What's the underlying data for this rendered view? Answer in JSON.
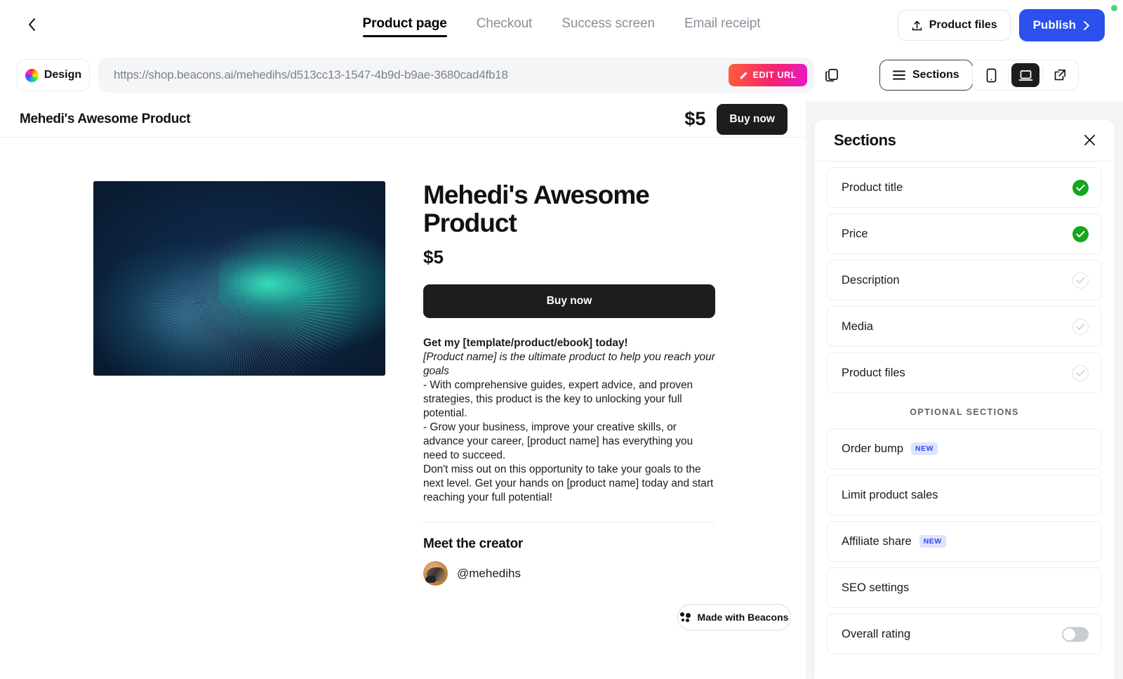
{
  "topbar": {
    "back_icon": "chevron-left-icon",
    "tabs": [
      {
        "label": "Product page",
        "active": true
      },
      {
        "label": "Checkout",
        "active": false
      },
      {
        "label": "Success screen",
        "active": false
      },
      {
        "label": "Email receipt",
        "active": false
      }
    ],
    "product_files_label": "Product files",
    "publish_label": "Publish",
    "status_dot_color": "#4ad66d",
    "publish_color": "#2b50ed"
  },
  "urlbar": {
    "design_label": "Design",
    "url": "https://shop.beacons.ai/mehedihs/d513cc13-1547-4b9d-b9ae-3680cad4fb18",
    "edit_url_label": "EDIT URL",
    "sections_label": "Sections",
    "devices": [
      {
        "name": "mobile",
        "selected": false
      },
      {
        "name": "desktop",
        "selected": true
      },
      {
        "name": "external-link",
        "selected": false
      }
    ]
  },
  "preview": {
    "sticky_title": "Mehedi's Awesome Product",
    "sticky_price": "$5",
    "sticky_buy_label": "Buy now",
    "product_title": "Mehedi's Awesome Product",
    "product_price": "$5",
    "buy_now_label": "Buy now",
    "description": {
      "heading": "Get my [template/product/ebook] today!",
      "italic": "[Product name] is the ultimate product to help you reach your goals",
      "bullet1": "- With comprehensive guides, expert advice, and proven strategies, this product is the key to unlocking your full potential.",
      "bullet2": "- Grow your business, improve your creative skills, or advance your career, [product name] has everything you need to succeed.",
      "closing": "Don't miss out on this opportunity to take your goals to the next level. Get your hands on [product name] today and start reaching your full potential!"
    },
    "meet_creator_label": "Meet the creator",
    "creator_handle": "@mehedihs",
    "footer_badge": "Made with Beacons"
  },
  "sections_panel": {
    "title": "Sections",
    "items": [
      {
        "label": "Product title",
        "state": "on"
      },
      {
        "label": "Price",
        "state": "on"
      },
      {
        "label": "Description",
        "state": "off"
      },
      {
        "label": "Media",
        "state": "off"
      },
      {
        "label": "Product files",
        "state": "off"
      }
    ],
    "optional_header": "OPTIONAL SECTIONS",
    "optional_items": [
      {
        "label": "Order bump",
        "badge": "NEW",
        "toggle": false
      },
      {
        "label": "Limit product sales",
        "badge": "",
        "toggle": false
      },
      {
        "label": "Affiliate share",
        "badge": "NEW",
        "toggle": false
      },
      {
        "label": "SEO settings",
        "badge": "",
        "toggle": false
      },
      {
        "label": "Overall rating",
        "badge": "",
        "toggle": true
      }
    ],
    "badge_text_color": "#2b50ed",
    "check_on_color": "#16a61e"
  }
}
